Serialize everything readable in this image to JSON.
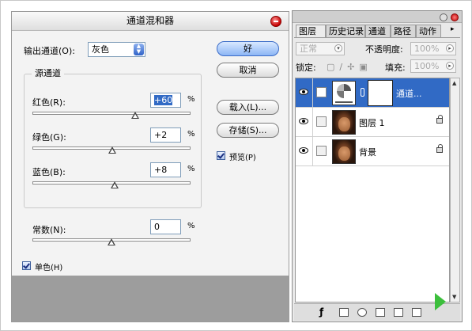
{
  "dialog": {
    "title": "通道混和器",
    "output_channel_label": "输出通道(O):",
    "output_channel_value": "灰色",
    "source_group_label": "源通道",
    "red_label": "红色(R):",
    "red_value": "+60",
    "green_label": "绿色(G):",
    "green_value": "+2",
    "blue_label": "蓝色(B):",
    "blue_value": "+8",
    "constant_label": "常数(N):",
    "constant_value": "0",
    "percent_symbol": "%",
    "ok_label": "好",
    "cancel_label": "取消",
    "load_label": "载入(L)...",
    "save_label": "存储(S)...",
    "preview_label": "预览(P)",
    "monochrome_label": "单色(H)",
    "preview_checked": true,
    "monochrome_checked": true,
    "slider_levels_percent": {
      "red": 60,
      "green": 2,
      "blue": 8,
      "constant": 0
    }
  },
  "layers_panel": {
    "tabs": [
      "图层",
      "历史记录",
      "通道",
      "路径",
      "动作"
    ],
    "blend_mode": "正常",
    "opacity_label": "不透明度:",
    "opacity_value": "100%",
    "lock_label": "锁定:",
    "fill_label": "填充:",
    "fill_value": "100%",
    "layers": [
      {
        "name": "通道...",
        "type": "adjustment",
        "selected": true,
        "visible": true
      },
      {
        "name": "图层 1",
        "type": "image",
        "selected": false,
        "visible": true,
        "locked": true
      },
      {
        "name": "背景",
        "type": "image",
        "selected": false,
        "visible": true,
        "locked": true
      }
    ]
  },
  "colors": {
    "selection": "#316ac5",
    "dialog_bg": "#f3f3f3",
    "default_button": "#8cb5f5",
    "close_button": "#c40000",
    "watermark_arrow": "#3cbf3c"
  }
}
